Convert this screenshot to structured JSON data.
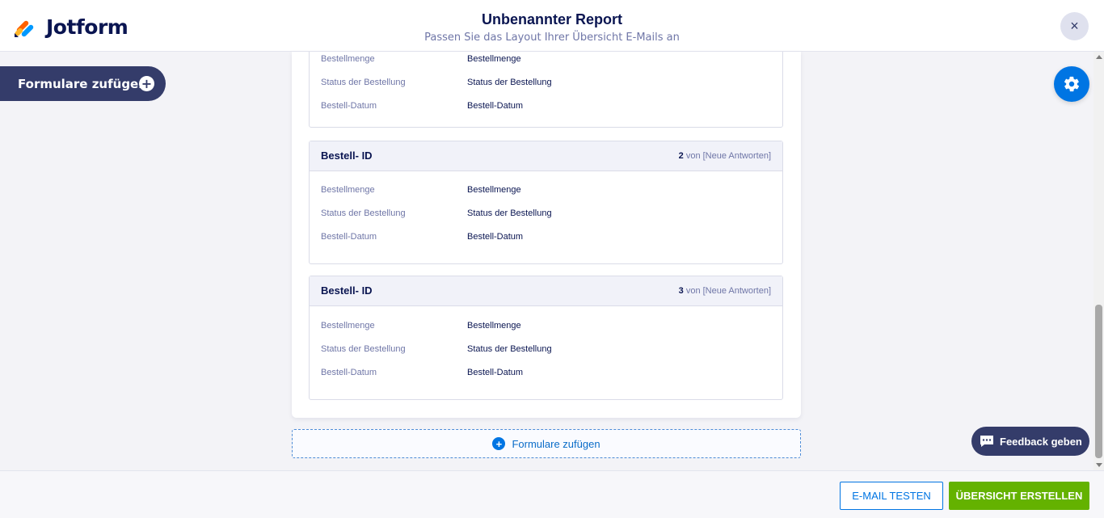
{
  "header": {
    "logo_text": "Jotform",
    "title": "Unbenannter Report",
    "subtitle": "Passen Sie das Layout Ihrer Übersicht E-Mails an",
    "close_label": "×"
  },
  "sidebar": {
    "add_forms_label": "Formulare zufügen",
    "add_icon": "+"
  },
  "blocks": [
    {
      "name": "",
      "number": "",
      "count_suffix": "",
      "rows": [
        {
          "label": "Bestellmenge",
          "value": "Bestellmenge"
        },
        {
          "label": "Status der Bestellung",
          "value": "Status der Bestellung"
        },
        {
          "label": "Bestell-Datum",
          "value": "Bestell-Datum"
        }
      ]
    },
    {
      "name": "Bestell- ID",
      "number": "2",
      "count_suffix": " von [Neue Antworten]",
      "rows": [
        {
          "label": "Bestellmenge",
          "value": "Bestellmenge"
        },
        {
          "label": "Status der Bestellung",
          "value": "Status der Bestellung"
        },
        {
          "label": "Bestell-Datum",
          "value": "Bestell-Datum"
        }
      ]
    },
    {
      "name": "Bestell- ID",
      "number": "3",
      "count_suffix": " von [Neue Antworten]",
      "rows": [
        {
          "label": "Bestellmenge",
          "value": "Bestellmenge"
        },
        {
          "label": "Status der Bestellung",
          "value": "Status der Bestellung"
        },
        {
          "label": "Bestell-Datum",
          "value": "Bestell-Datum"
        }
      ]
    }
  ],
  "add_forms_bottom": {
    "label": "Formulare zufügen",
    "icon": "+"
  },
  "feedback": {
    "label": "Feedback geben"
  },
  "footer": {
    "test_label": "E-MAIL TESTEN",
    "create_label": "ÜBERSICHT ERSTELLEN"
  },
  "colors": {
    "accent": "#0075e3",
    "create_button": "#64b200",
    "dark": "#343c6a",
    "navy_text": "#0a1551"
  },
  "icons": {
    "logo": "jotform-logo-icon",
    "close": "close-icon",
    "gear": "gear-icon",
    "add": "plus-circle-icon",
    "feedback": "feedback-chat-icon"
  }
}
